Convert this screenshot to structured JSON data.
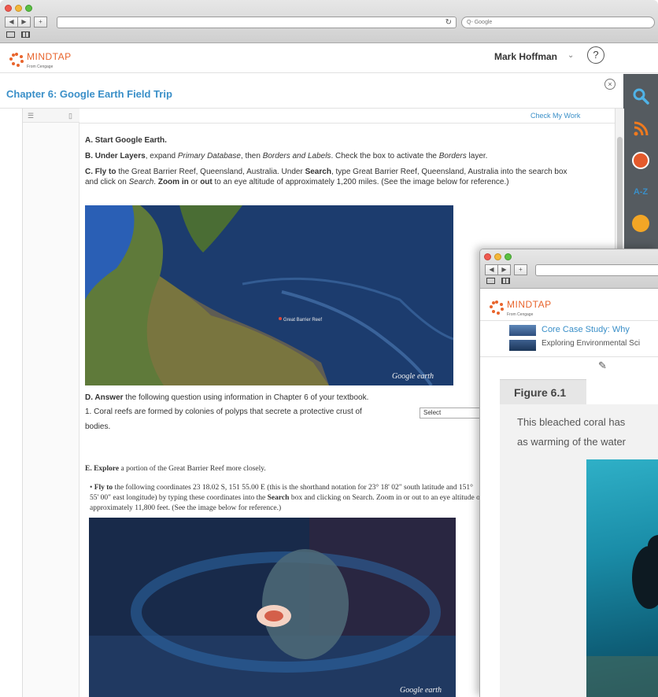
{
  "browser": {
    "search_placeholder": "Q- Google",
    "reload_icon": "reload-icon",
    "tab_icons": [
      "tab-icon",
      "grid-icon"
    ]
  },
  "header": {
    "logo_text": "MINDTAP",
    "logo_sub": "From Cengage",
    "user_name": "Mark Hoffman",
    "help_label": "?"
  },
  "chapter": {
    "title": "Chapter 6: Google Earth Field Trip",
    "close_label": "×"
  },
  "dock": {
    "items": [
      "search-icon",
      "rss-icon",
      "web-icon",
      "a-z-icon",
      "note-icon"
    ],
    "colors": {
      "search": "#4fb3e8",
      "rss": "#f07a1e",
      "web": "#e45a2c",
      "az": "#3a8fc8",
      "note": "#f3a626"
    }
  },
  "reader": {
    "check_link": "Check My Work",
    "sections": {
      "a": "A. Start Google Earth.",
      "b_pre": "B. Under ",
      "b_layers": "Layers",
      "b_mid": ", expand ",
      "b_primary": "Primary Database",
      "b_then": ", then ",
      "b_borders": "Borders and Labels",
      "b_post": ". Check the box to activate the ",
      "b_borders2": "Borders",
      "b_end": " layer.",
      "c_label": "C. Fly to",
      "c_text1": " the Great Barrier Reef, Queensland, Australia. Under ",
      "c_search": "Search",
      "c_text2": ", type Great Barrier Reef, Queensland, Australia into the search box and click on ",
      "c_search2": "Search",
      "c_text3": ". ",
      "c_zoom": "Zoom in",
      "c_or": " or ",
      "c_out": "out",
      "c_text4": " to an eye altitude of approximately 1,200 miles. (See the image below for reference.)",
      "d_label": "D. Answer",
      "d_text": " the following question using information in Chapter 6 of your textbook.",
      "d1_text": "1. Coral reefs are formed by colonies of polyps that secrete a protective crust of",
      "d1_select": "Select",
      "d1_end": "bodies.",
      "e_label": "E. Explore",
      "e_text": " a portion of the Great Barrier Reef more closely.",
      "e1_label": "Fly to",
      "e1_text1": " the following coordinates 23 18.02 S, 151 55.00 E (this is the shorthand notation for 23° 18' 02\" south latitude and 151° 55' 00\" east longitude) by typing these coordinates into the ",
      "e1_search": "Search",
      "e1_text2": " box and clicking on Search. Zoom in or out to an eye altitude of approximately 11,800 feet. (See the image below for reference.)"
    },
    "map1_labels": {
      "watermark": "Google earth",
      "reef": "Great Barrier Reef"
    },
    "map2_labels": {
      "watermark": "Google earth"
    }
  },
  "second_window": {
    "logo_text": "MINDTAP",
    "logo_sub": "From Cengage",
    "case_title": "Core Case Study: Why",
    "case_subtitle": "Exploring Environmental Sci",
    "pencil_icon": "pencil-icon",
    "figure_label": "Figure 6.1",
    "caption_line1": "This bleached coral has",
    "caption_line2": "as warming of the water"
  }
}
